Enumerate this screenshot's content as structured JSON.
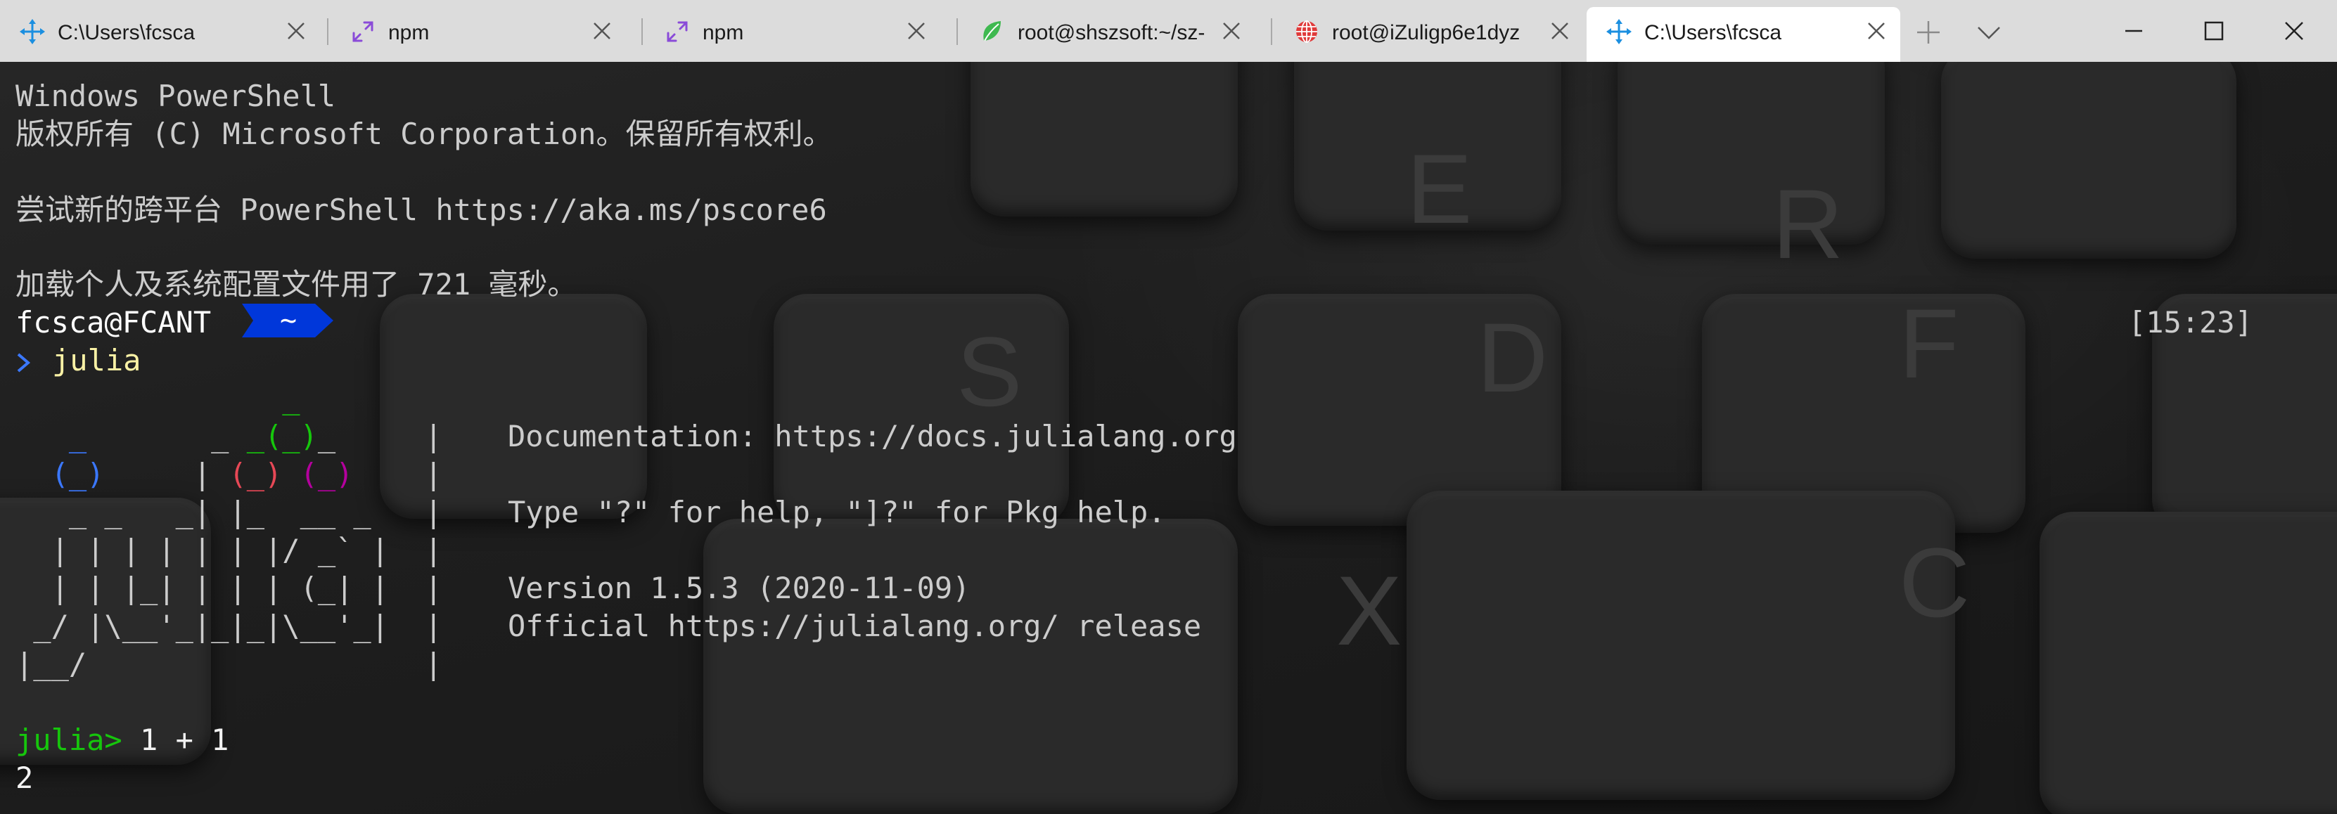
{
  "tabs": [
    {
      "label": "C:\\Users\\fcsca",
      "icon": "powershell-move-icon",
      "active": false
    },
    {
      "label": "npm",
      "icon": "resize-arrows-icon",
      "active": false
    },
    {
      "label": "npm",
      "icon": "resize-arrows-icon",
      "active": false
    },
    {
      "label": "root@shszsoft:~/sz-",
      "icon": "leaf-icon",
      "active": false
    },
    {
      "label": "root@iZuligp6e1dyz",
      "icon": "globe-icon",
      "active": false
    },
    {
      "label": "C:\\Users\\fcsca",
      "icon": "powershell-move-icon",
      "active": true
    }
  ],
  "tabbar": {
    "new_tab_icon": "plus-icon",
    "dropdown_icon": "chevron-down-icon",
    "window_controls": [
      "minimize-icon",
      "maximize-icon",
      "close-icon"
    ]
  },
  "terminal": {
    "header_line1": "Windows PowerShell",
    "header_line2": "版权所有 (C) Microsoft Corporation。保留所有权利。",
    "header_line3": "尝试新的跨平台 PowerShell https://aka.ms/pscore6",
    "header_line4": "加载个人及系统配置文件用了 721 毫秒。",
    "prompt_user": "fcsca@FCANT",
    "prompt_path": "~",
    "prompt_time": "[15:23]",
    "command": "julia",
    "banner_info": {
      "doc": "Documentation: https://docs.julialang.org",
      "help": "Type \"?\" for help, \"]?\" for Pkg help.",
      "version": "Version 1.5.3 (2020-11-09)",
      "release": "Official https://julialang.org/ release"
    },
    "julia_prompt": "julia>",
    "julia_input": " 1 + 1",
    "julia_output": "2"
  },
  "colors": {
    "tabbar_bg": "#dcdcdc",
    "active_tab_bg": "#ffffff",
    "terminal_text": "#cccccc",
    "command_yellow": "#f9f1a5",
    "julia_green": "#16c60c",
    "julia_blue": "#3b78ff",
    "julia_red": "#e74856",
    "julia_purple": "#b4009e",
    "path_badge": "#0037da"
  }
}
